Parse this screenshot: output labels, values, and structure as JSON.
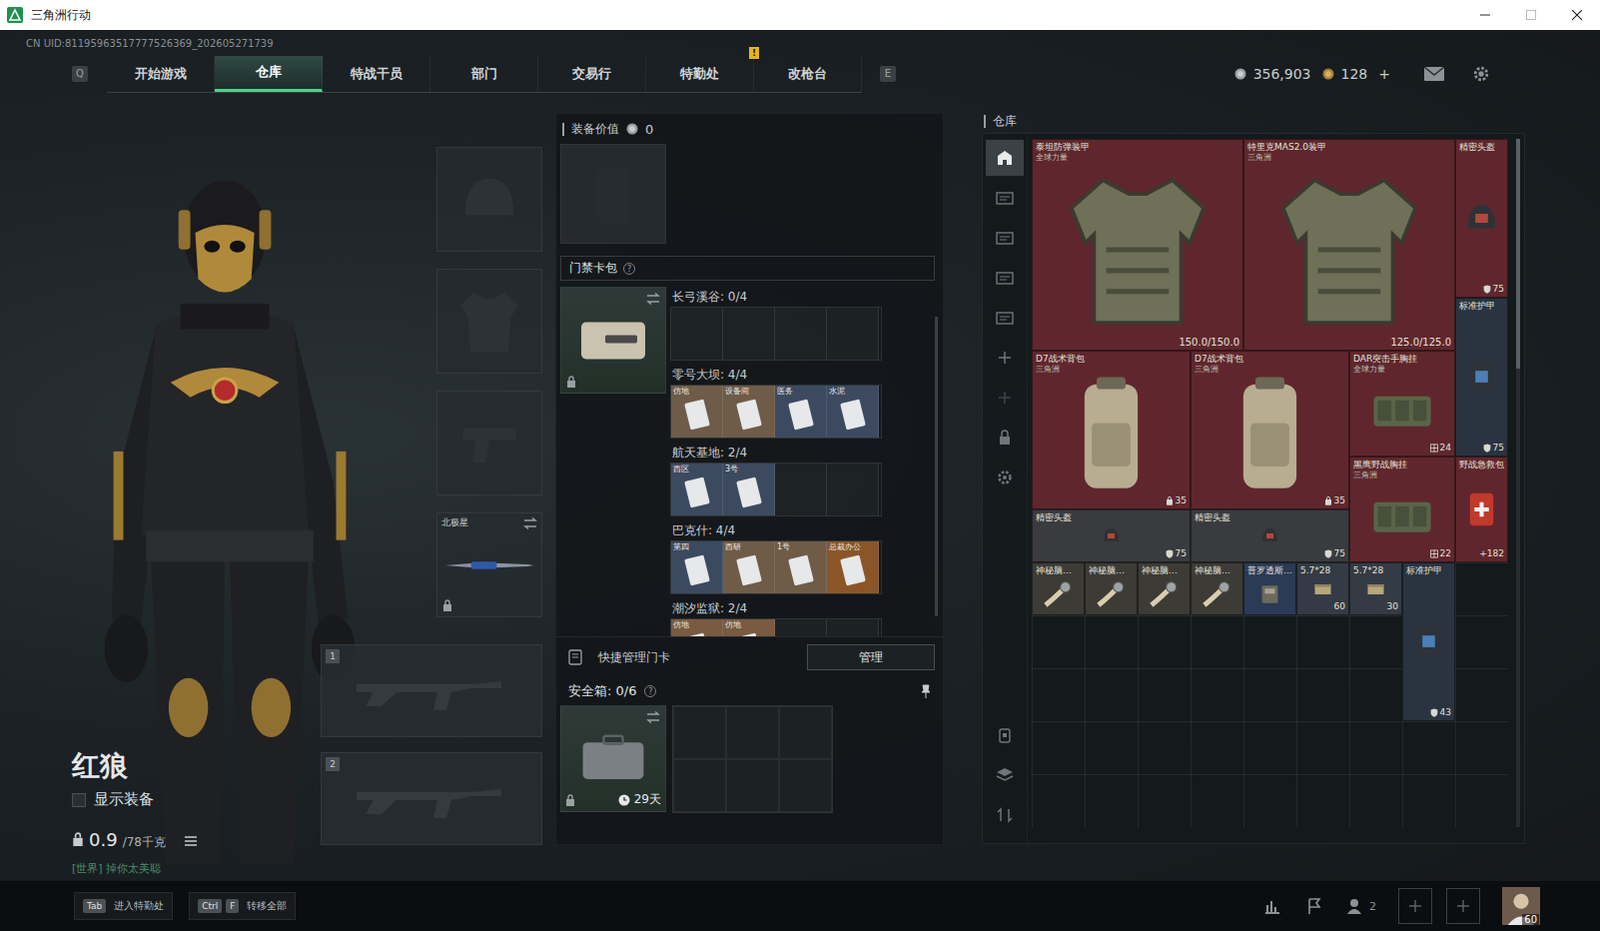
{
  "window": {
    "title": "三角洲行动"
  },
  "uid": "CN UID:81195963517777526369_202605271739",
  "nav": {
    "leftKey": "Q",
    "rightKey": "E",
    "tabs": [
      {
        "label": "开始游戏",
        "selected": false,
        "alert": ""
      },
      {
        "label": "仓库",
        "selected": true,
        "alert": ""
      },
      {
        "label": "特战干员",
        "selected": false,
        "alert": ""
      },
      {
        "label": "部门",
        "selected": false,
        "alert": ""
      },
      {
        "label": "交易行",
        "selected": false,
        "alert": ""
      },
      {
        "label": "特勤处",
        "selected": false,
        "alert": "!"
      },
      {
        "label": "改枪台",
        "selected": false,
        "alert": ""
      }
    ]
  },
  "currency": {
    "coins": "356,903",
    "tokens": "128",
    "add": "+"
  },
  "operator": {
    "name": "红狼",
    "showGear": {
      "label": "显示装备",
      "checked": false
    },
    "weight": "0.9",
    "weightMax": "/78千克",
    "chat": "[世界] 掉你太美聪"
  },
  "gear": {
    "slots": [
      {
        "kind": "helmet",
        "label": "",
        "locked": false
      },
      {
        "kind": "armor",
        "label": "",
        "locked": false
      },
      {
        "kind": "pistol",
        "label": "",
        "locked": false
      },
      {
        "kind": "melee",
        "label": "北极星",
        "locked": true
      }
    ],
    "weapons": [
      {
        "index": "1"
      },
      {
        "index": "2"
      }
    ]
  },
  "loadout": {
    "label": "装备价值",
    "value": "0"
  },
  "cardPack": {
    "title": "门禁卡包",
    "help": "?",
    "locked": true,
    "maps": [
      {
        "title": "长弓溪谷: 0/4",
        "slots": 4,
        "cards": []
      },
      {
        "title": "零号大坝: 4/4",
        "slots": 4,
        "cards": [
          {
            "label": "仿地",
            "color": "#6e5c48"
          },
          {
            "label": "设备间",
            "color": "#6e5c48"
          },
          {
            "label": "医务",
            "color": "#3c4a60"
          },
          {
            "label": "水泥",
            "color": "#3c4a60"
          }
        ]
      },
      {
        "title": "航天基地: 2/4",
        "slots": 4,
        "cards": [
          {
            "label": "西区",
            "color": "#3c4a60"
          },
          {
            "label": "3号",
            "color": "#3c4a60"
          }
        ]
      },
      {
        "title": "巴克什: 4/4",
        "slots": 4,
        "cards": [
          {
            "label": "第四",
            "color": "#3c4a60"
          },
          {
            "label": "西研",
            "color": "#6e5c48"
          },
          {
            "label": "1号",
            "color": "#6e5c48"
          },
          {
            "label": "总裁办公",
            "color": "#8a5628"
          }
        ]
      },
      {
        "title": "潮汐监狱: 2/4",
        "slots": 4,
        "cards": [
          {
            "label": "仿地",
            "color": "#7a5a40"
          },
          {
            "label": "仿地",
            "color": "#7a5a40"
          }
        ]
      }
    ]
  },
  "quickManage": {
    "label": "快捷管理门卡",
    "button": "管理"
  },
  "safeBox": {
    "title": "安全箱: 0/6",
    "help": "?",
    "time": "29天",
    "cells": 6,
    "locked": true
  },
  "warehouse": {
    "title": "仓库",
    "sidebarTop": [
      {
        "kind": "home",
        "selected": true,
        "disabled": false
      },
      {
        "kind": "case",
        "selected": false,
        "disabled": false
      },
      {
        "kind": "case",
        "selected": false,
        "disabled": false
      },
      {
        "kind": "case",
        "selected": false,
        "disabled": false
      },
      {
        "kind": "case",
        "selected": false,
        "disabled": false
      },
      {
        "kind": "plus",
        "selected": false,
        "disabled": false
      },
      {
        "kind": "plus",
        "selected": false,
        "disabled": true
      },
      {
        "kind": "lock",
        "selected": false,
        "disabled": false
      },
      {
        "kind": "gear",
        "selected": false,
        "disabled": false
      }
    ],
    "sidebarBottom": [
      {
        "kind": "bag",
        "selected": false,
        "disabled": false
      },
      {
        "kind": "layers",
        "selected": false,
        "disabled": false
      },
      {
        "kind": "sort",
        "selected": false,
        "disabled": false
      }
    ],
    "items": [
      {
        "name": "泰坦防弹装甲",
        "sub": "全球力量",
        "kind": "armor",
        "stat": "",
        "reading": "150.0/150.0",
        "color": "#5f272d"
      },
      {
        "name": "特里克MAS2.0装甲",
        "sub": "三角洲",
        "kind": "armor",
        "stat": "",
        "reading": "125.0/125.0",
        "color": "#5f272d"
      },
      {
        "name": "精密头盔",
        "sub": "",
        "kind": "helmet",
        "stat": "75",
        "reading": "",
        "color": "#5f272d"
      },
      {
        "name": "标准护甲",
        "sub": "",
        "kind": "vest",
        "stat": "75",
        "reading": "",
        "color": "#2a3440"
      },
      {
        "name": "D7战术背包",
        "sub": "三角洲",
        "kind": "backpack",
        "stat": "35",
        "reading": "",
        "color": "#5f272d"
      },
      {
        "name": "D7战术背包",
        "sub": "三角洲",
        "kind": "backpack",
        "stat": "35",
        "reading": "",
        "color": "#5f272d"
      },
      {
        "name": "DAR突击手胸挂",
        "sub": "全球力量",
        "kind": "rig",
        "stat": "24",
        "reading": "",
        "color": "#5f272d"
      },
      {
        "name": "黑鹰野战胸挂",
        "sub": "三角洲",
        "kind": "rig",
        "stat": "22",
        "reading": "",
        "color": "#5f272d"
      },
      {
        "name": "野战急救包",
        "sub": "",
        "kind": "medkit",
        "stat": "+182",
        "reading": "",
        "color": "#5f272d"
      },
      {
        "name": "精密头盔",
        "sub": "",
        "kind": "helmet",
        "stat": "75",
        "reading": "",
        "color": "#393b3e"
      },
      {
        "name": "精密头盔",
        "sub": "",
        "kind": "helmet",
        "stat": "75",
        "reading": "",
        "color": "#393b3e"
      },
      {
        "name": "神秘脑…",
        "sub": "",
        "kind": "watch",
        "stat": "",
        "reading": "",
        "color": "#3d3b36"
      },
      {
        "name": "神秘脑…",
        "sub": "",
        "kind": "watch",
        "stat": "",
        "reading": "",
        "color": "#3d3b36"
      },
      {
        "name": "神秘脑…",
        "sub": "",
        "kind": "watch",
        "stat": "",
        "reading": "",
        "color": "#3d3b36"
      },
      {
        "name": "神秘脑…",
        "sub": "",
        "kind": "watch",
        "stat": "",
        "reading": "",
        "color": "#3d3b36"
      },
      {
        "name": "普罗透斯…",
        "sub": "",
        "kind": "device",
        "stat": "",
        "reading": "",
        "color": "#2b3a55"
      },
      {
        "name": "5.7*28",
        "sub": "",
        "kind": "ammo",
        "stat": "60",
        "reading": "",
        "color": "#343b44"
      },
      {
        "name": "5.7*28",
        "sub": "",
        "kind": "ammo",
        "stat": "30",
        "reading": "",
        "color": "#343b44"
      },
      {
        "name": "标准护甲",
        "sub": "",
        "kind": "vest",
        "stat": "43",
        "reading": "",
        "color": "#2a3440"
      }
    ]
  },
  "bottomBar": {
    "hints": [
      {
        "keys": [
          "Tab"
        ],
        "label": "进入特勤处"
      },
      {
        "keys": [
          "Ctrl",
          "F"
        ],
        "label": "转移全部"
      }
    ],
    "friends": "2",
    "level": "60"
  }
}
